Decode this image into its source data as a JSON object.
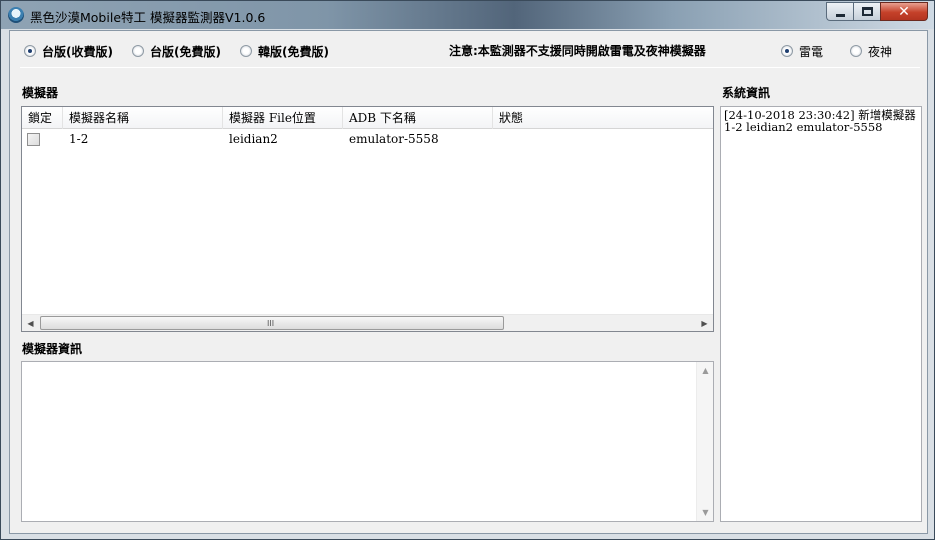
{
  "window": {
    "title": "黑色沙漠Mobile特工 模擬器監測器V1.0.6",
    "close_glyph": "✕"
  },
  "version_options": [
    {
      "label": "台版(收費版)",
      "checked": true
    },
    {
      "label": "台版(免費版)",
      "checked": false
    },
    {
      "label": "韓版(免費版)",
      "checked": false
    }
  ],
  "notice": "注意:本監測器不支援同時開啟雷電及夜神模擬器",
  "emulator_options": [
    {
      "label": "雷電",
      "checked": true
    },
    {
      "label": "夜神",
      "checked": false
    }
  ],
  "emulator_section": {
    "label": "模擬器",
    "columns": [
      "鎖定",
      "模擬器名稱",
      "模擬器 File位置",
      "ADB 下名稱",
      "狀態"
    ],
    "rows": [
      {
        "locked": false,
        "name": "1-2",
        "file_location": "leidian2",
        "adb_name": "emulator-5558",
        "status": ""
      }
    ],
    "scroll_left": "◀",
    "scroll_right": "▶",
    "scroll_grip": "III"
  },
  "emulator_info": {
    "label": "模擬器資訊",
    "content": "",
    "scroll_up": "▲",
    "scroll_down": "▼"
  },
  "system_info": {
    "label": "系統資訊",
    "log": "[24-10-2018 23:30:42] 新增模擬器1-2 leidian2 emulator-5558"
  }
}
